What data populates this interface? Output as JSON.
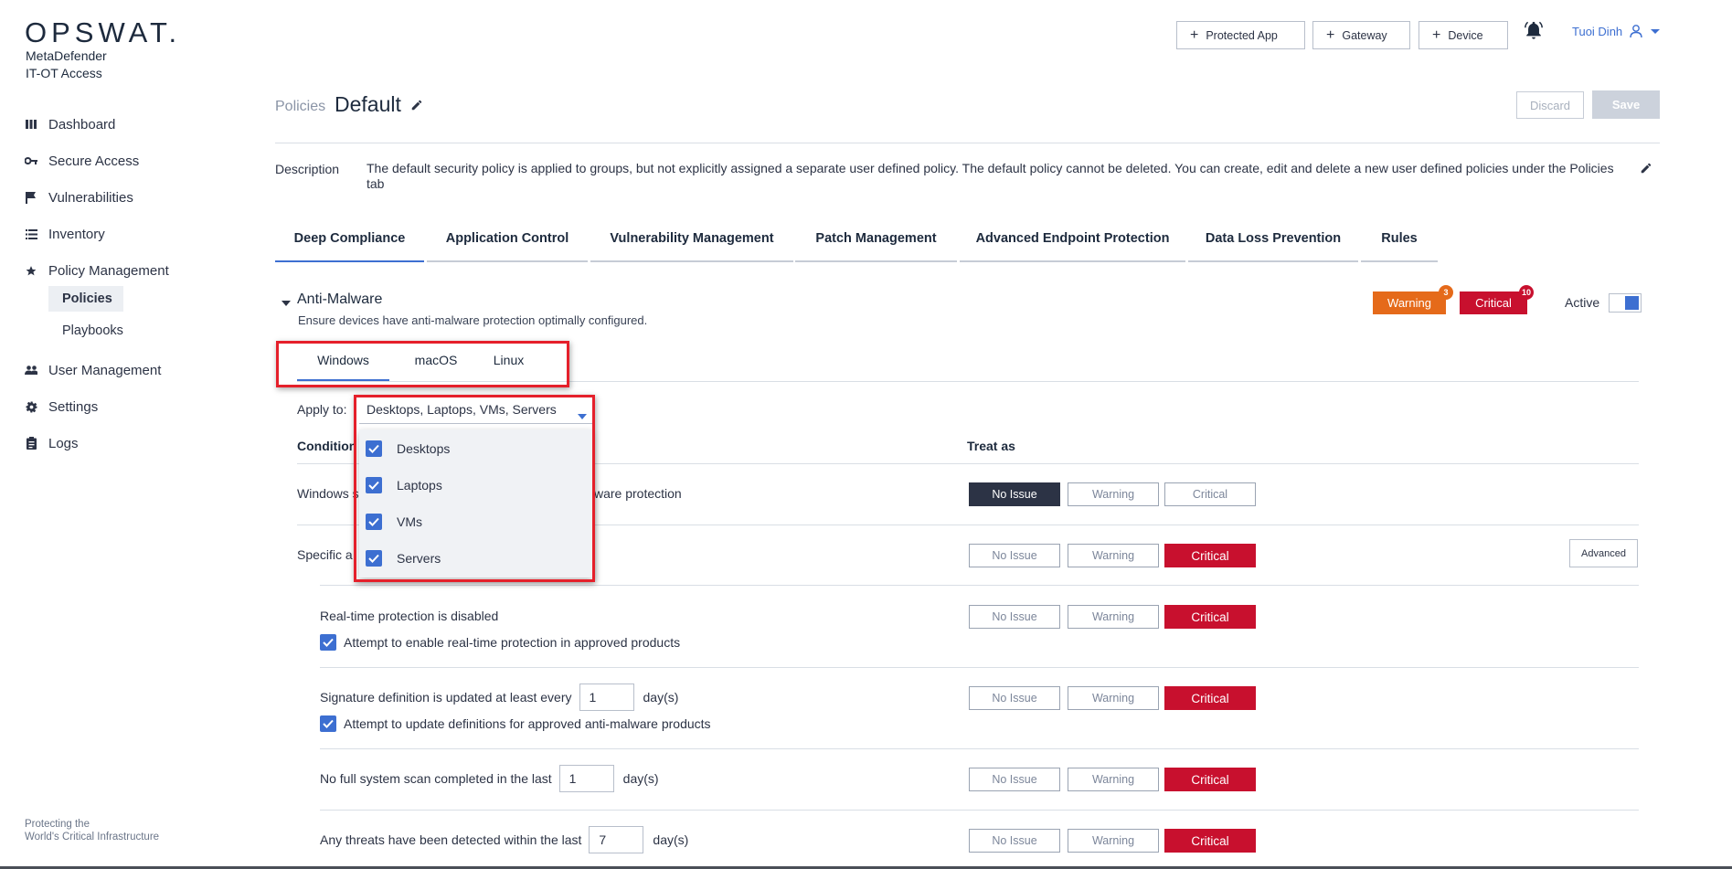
{
  "sidebar": {
    "logo": "OPSWAT",
    "logo_dot": ".",
    "product_line1": "MetaDefender",
    "product_line2": "IT-OT Access",
    "items": [
      {
        "label": "Dashboard",
        "icon": "bar-chart-icon"
      },
      {
        "label": "Secure Access",
        "icon": "key-icon"
      },
      {
        "label": "Vulnerabilities",
        "icon": "flag-icon"
      },
      {
        "label": "Inventory",
        "icon": "list-icon"
      },
      {
        "label": "Policy Management",
        "icon": "star-icon"
      },
      {
        "label": "User Management",
        "icon": "users-icon"
      },
      {
        "label": "Settings",
        "icon": "gear-icon"
      },
      {
        "label": "Logs",
        "icon": "clipboard-icon"
      }
    ],
    "sub_items": [
      "Policies",
      "Playbooks"
    ],
    "tagline_line1": "Protecting the",
    "tagline_line2": "World's Critical Infrastructure"
  },
  "header": {
    "buttons": [
      "Protected App",
      "Gateway",
      "Device"
    ],
    "user_name": "Tuoi Dinh"
  },
  "page": {
    "breadcrumb": "Policies",
    "title": "Default",
    "discard_label": "Discard",
    "save_label": "Save",
    "description_label": "Description",
    "description_text": "The default security policy is applied to groups, but not explicitly assigned a separate user defined policy. The default policy cannot be deleted. You can create, edit and delete a new user defined policies under the Policies tab"
  },
  "tabs": [
    "Deep Compliance",
    "Application Control",
    "Vulnerability Management",
    "Patch Management",
    "Advanced Endpoint Protection",
    "Data Loss Prevention",
    "Rules"
  ],
  "section": {
    "title": "Anti-Malware",
    "subtitle": "Ensure devices have anti-malware protection optimally configured.",
    "warning_label": "Warning",
    "warning_count": "3",
    "critical_label": "Critical",
    "critical_count": "10",
    "active_label": "Active",
    "active": true
  },
  "os_tabs": [
    "Windows",
    "macOS",
    "Linux"
  ],
  "apply_to": {
    "label": "Apply to:",
    "value": "Desktops, Laptops, VMs, Servers",
    "options": [
      "Desktops",
      "Laptops",
      "VMs",
      "Servers"
    ]
  },
  "table": {
    "col_condition": "Condition",
    "col_treat": "Treat as",
    "seg_labels": [
      "No Issue",
      "Warning",
      "Critical"
    ],
    "advanced_label": "Advanced",
    "rows": [
      {
        "text_left": "Windows s",
        "text_right": "ware protection",
        "selected": "No Issue"
      },
      {
        "text_left": "Specific a",
        "selected": "Critical"
      },
      {
        "text": "Real-time protection is disabled",
        "check": "Attempt to enable real-time protection in approved products",
        "selected": "Critical"
      },
      {
        "pre": "Signature definition is updated at least every",
        "value": "1",
        "unit": "day(s)",
        "check": "Attempt to update definitions for approved anti-malware products",
        "selected": "Critical"
      },
      {
        "pre": "No full system scan completed in the last",
        "value": "1",
        "unit": "day(s)",
        "selected": "Critical"
      },
      {
        "pre": "Any threats have been detected within the last",
        "value": "7",
        "unit": "day(s)",
        "selected": "Critical"
      }
    ]
  }
}
